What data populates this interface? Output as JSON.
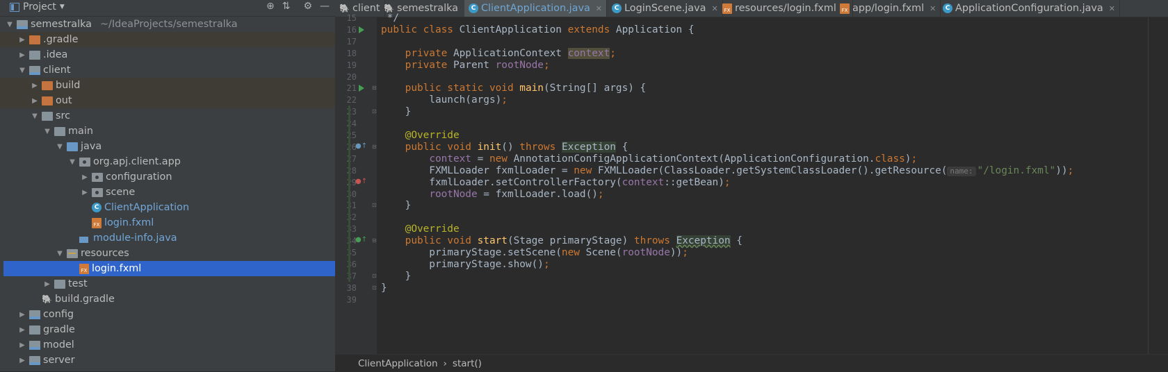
{
  "project_panel": {
    "title": "Project",
    "icons": [
      "globe-icon",
      "collapse-icon",
      "gear-icon",
      "hide-icon"
    ],
    "tree": [
      {
        "label": "semestralka",
        "path": "~/IdeaProjects/semestralka",
        "indent": 0,
        "arrow": "down",
        "icon": "module-folder"
      },
      {
        "label": ".gradle",
        "indent": 1,
        "arrow": "right",
        "icon": "excluded-folder",
        "excluded": true
      },
      {
        "label": ".idea",
        "indent": 1,
        "arrow": "right",
        "icon": "folder"
      },
      {
        "label": "client",
        "indent": 1,
        "arrow": "down",
        "icon": "module-folder"
      },
      {
        "label": "build",
        "indent": 2,
        "arrow": "right",
        "icon": "excluded-folder",
        "excluded": true
      },
      {
        "label": "out",
        "indent": 2,
        "arrow": "right",
        "icon": "excluded-folder",
        "excluded": true
      },
      {
        "label": "src",
        "indent": 2,
        "arrow": "down",
        "icon": "folder"
      },
      {
        "label": "main",
        "indent": 3,
        "arrow": "down",
        "icon": "folder"
      },
      {
        "label": "java",
        "indent": 4,
        "arrow": "down",
        "icon": "source-folder"
      },
      {
        "label": "org.apj.client.app",
        "indent": 5,
        "arrow": "down",
        "icon": "package"
      },
      {
        "label": "configuration",
        "indent": 6,
        "arrow": "right",
        "icon": "package"
      },
      {
        "label": "scene",
        "indent": 6,
        "arrow": "right",
        "icon": "package"
      },
      {
        "label": "ClientApplication",
        "indent": 6,
        "arrow": "none",
        "icon": "class",
        "blue": true
      },
      {
        "label": "login.fxml",
        "indent": 6,
        "arrow": "none",
        "icon": "fxml",
        "blue": true
      },
      {
        "label": "module-info.java",
        "indent": 5,
        "arrow": "none",
        "icon": "module-info",
        "blue": true
      },
      {
        "label": "resources",
        "indent": 4,
        "arrow": "down",
        "icon": "resources-folder"
      },
      {
        "label": "login.fxml",
        "indent": 5,
        "arrow": "none",
        "icon": "fxml",
        "selected": true
      },
      {
        "label": "test",
        "indent": 3,
        "arrow": "right",
        "icon": "folder"
      },
      {
        "label": "build.gradle",
        "indent": 2,
        "arrow": "none",
        "icon": "gradle"
      },
      {
        "label": "config",
        "indent": 1,
        "arrow": "right",
        "icon": "module-folder"
      },
      {
        "label": "gradle",
        "indent": 1,
        "arrow": "right",
        "icon": "folder"
      },
      {
        "label": "model",
        "indent": 1,
        "arrow": "right",
        "icon": "module-folder"
      },
      {
        "label": "server",
        "indent": 1,
        "arrow": "right",
        "icon": "module-folder"
      }
    ]
  },
  "tabs": [
    {
      "label": "client",
      "icon": "gradle",
      "active": false,
      "closable": false
    },
    {
      "label": "semestralka",
      "icon": "gradle",
      "active": false,
      "closable": true
    },
    {
      "label": "ClientApplication.java",
      "icon": "class",
      "active": true,
      "closable": true
    },
    {
      "label": "LoginScene.java",
      "icon": "class",
      "active": false,
      "closable": true
    },
    {
      "label": "resources/login.fxml",
      "icon": "fxml",
      "active": false,
      "closable": true
    },
    {
      "label": "app/login.fxml",
      "icon": "fxml",
      "active": false,
      "closable": true
    },
    {
      "label": "ApplicationConfiguration.java",
      "icon": "class",
      "active": false,
      "closable": true
    }
  ],
  "editor": {
    "lines": [
      {
        "n": 15,
        "tokens": [
          {
            "t": " */",
            "c": ""
          }
        ]
      },
      {
        "n": 16,
        "run": true,
        "tokens": [
          {
            "t": "public class ",
            "c": "kw"
          },
          {
            "t": "ClientApplication ",
            "c": ""
          },
          {
            "t": "extends ",
            "c": "kw"
          },
          {
            "t": "Application {",
            "c": ""
          }
        ]
      },
      {
        "n": 17,
        "tokens": []
      },
      {
        "n": 18,
        "tokens": [
          {
            "t": "    private ",
            "c": "kw"
          },
          {
            "t": "ApplicationContext ",
            "c": ""
          },
          {
            "t": "context",
            "c": "fld ctx"
          },
          {
            "t": ";",
            "c": "kw"
          }
        ]
      },
      {
        "n": 19,
        "tokens": [
          {
            "t": "    private ",
            "c": "kw"
          },
          {
            "t": "Parent ",
            "c": ""
          },
          {
            "t": "rootNode",
            "c": "fld"
          },
          {
            "t": ";",
            "c": "kw"
          }
        ]
      },
      {
        "n": 20,
        "tokens": []
      },
      {
        "n": 21,
        "run": true,
        "fold": "open",
        "tokens": [
          {
            "t": "    public static void ",
            "c": "kw"
          },
          {
            "t": "main",
            "c": "fn"
          },
          {
            "t": "(String[] args) {",
            "c": ""
          }
        ]
      },
      {
        "n": 22,
        "tokens": [
          {
            "t": "        launch(args)",
            "c": ""
          },
          {
            "t": ";",
            "c": "kw"
          }
        ]
      },
      {
        "n": 23,
        "fold": "close",
        "tokens": [
          {
            "t": "    }",
            "c": ""
          }
        ]
      },
      {
        "n": 24,
        "tokens": []
      },
      {
        "n": 25,
        "tokens": [
          {
            "t": "    @Override",
            "c": "ann"
          }
        ]
      },
      {
        "n": 26,
        "override": "blue",
        "fold": "open",
        "tokens": [
          {
            "t": "    public void ",
            "c": "kw"
          },
          {
            "t": "init",
            "c": "fn"
          },
          {
            "t": "() ",
            "c": ""
          },
          {
            "t": "throws ",
            "c": "kw"
          },
          {
            "t": "Exception",
            "c": "exc"
          },
          {
            "t": " {",
            "c": ""
          }
        ]
      },
      {
        "n": 27,
        "tokens": [
          {
            "t": "        ",
            "c": ""
          },
          {
            "t": "context",
            "c": "fld"
          },
          {
            "t": " = ",
            "c": ""
          },
          {
            "t": "new ",
            "c": "kw"
          },
          {
            "t": "AnnotationConfigApplicationContext(ApplicationConfiguration.",
            "c": ""
          },
          {
            "t": "class",
            "c": "kw"
          },
          {
            "t": ")",
            "c": ""
          },
          {
            "t": ";",
            "c": "kw"
          }
        ]
      },
      {
        "n": 28,
        "tokens": [
          {
            "t": "        FXMLLoader fxmlLoader = ",
            "c": ""
          },
          {
            "t": "new ",
            "c": "kw"
          },
          {
            "t": "FXMLLoader(ClassLoader.getSystemClassLoader().getResource(",
            "c": ""
          },
          {
            "t": "name:",
            "c": "hint"
          },
          {
            "t": "\"/login.fxml\"",
            "c": "str"
          },
          {
            "t": "))",
            "c": ""
          },
          {
            "t": ";",
            "c": "kw"
          }
        ]
      },
      {
        "n": 29,
        "override": "red",
        "tokens": [
          {
            "t": "        fxmlLoader.setControllerFactory(",
            "c": ""
          },
          {
            "t": "context",
            "c": "fld"
          },
          {
            "t": "::getBean)",
            "c": ""
          },
          {
            "t": ";",
            "c": "kw"
          }
        ]
      },
      {
        "n": 30,
        "tokens": [
          {
            "t": "        ",
            "c": ""
          },
          {
            "t": "rootNode",
            "c": "fld"
          },
          {
            "t": " = fxmlLoader.load()",
            "c": ""
          },
          {
            "t": ";",
            "c": "kw"
          }
        ]
      },
      {
        "n": 31,
        "fold": "close",
        "tokens": [
          {
            "t": "    }",
            "c": ""
          }
        ]
      },
      {
        "n": 32,
        "tokens": []
      },
      {
        "n": 33,
        "tokens": [
          {
            "t": "    @Override",
            "c": "ann"
          }
        ]
      },
      {
        "n": 34,
        "override": "green",
        "fold": "open",
        "tokens": [
          {
            "t": "    public void ",
            "c": "kw"
          },
          {
            "t": "start",
            "c": "fn"
          },
          {
            "t": "(Stage primaryStage) ",
            "c": ""
          },
          {
            "t": "throws ",
            "c": "kw"
          },
          {
            "t": "Exception",
            "c": "exc wavy"
          },
          {
            "t": " {",
            "c": ""
          }
        ]
      },
      {
        "n": 35,
        "tokens": [
          {
            "t": "        primaryStage.setScene(",
            "c": ""
          },
          {
            "t": "new ",
            "c": "kw"
          },
          {
            "t": "Scene(",
            "c": ""
          },
          {
            "t": "rootNode",
            "c": "fld"
          },
          {
            "t": "))",
            "c": ""
          },
          {
            "t": ";",
            "c": "kw"
          }
        ]
      },
      {
        "n": 36,
        "tokens": [
          {
            "t": "        primaryStage.show()",
            "c": ""
          },
          {
            "t": ";",
            "c": "kw"
          }
        ]
      },
      {
        "n": 37,
        "fold": "close",
        "tokens": [
          {
            "t": "    }",
            "c": ""
          }
        ]
      },
      {
        "n": 38,
        "fold": "close",
        "tokens": [
          {
            "t": "}",
            "c": ""
          }
        ]
      },
      {
        "n": 39,
        "tokens": []
      }
    ]
  },
  "breadcrumb": [
    "ClientApplication",
    "start()"
  ]
}
